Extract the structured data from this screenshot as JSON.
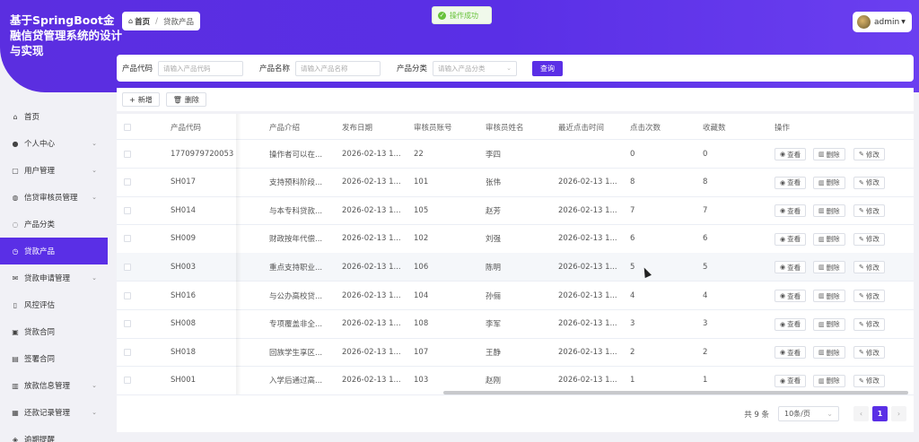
{
  "app": {
    "title": "基于SpringBoot金融信贷管理系统的设计与实现"
  },
  "breadcrumb": {
    "home": "首页",
    "separator": "/",
    "current": "贷款产品"
  },
  "toast": {
    "message": "操作成功"
  },
  "user": {
    "name": "admin"
  },
  "search": {
    "code_label": "产品代码",
    "code_placeholder": "请输入产品代码",
    "name_label": "产品名称",
    "name_placeholder": "请输入产品名称",
    "category_label": "产品分类",
    "category_placeholder": "请输入产品分类",
    "query_button": "查询"
  },
  "toolbar": {
    "add_label": "新增",
    "delete_label": "删除"
  },
  "sidebar": {
    "items": [
      {
        "label": "首页",
        "icon": "home-icon",
        "glyph": "⌂",
        "expandable": false,
        "active": false
      },
      {
        "label": "个人中心",
        "icon": "user-icon",
        "glyph": "●",
        "expandable": true,
        "active": false
      },
      {
        "label": "用户管理",
        "icon": "users-icon",
        "glyph": "▢",
        "expandable": true,
        "active": false
      },
      {
        "label": "信贷审核员管理",
        "icon": "reviewer-icon",
        "glyph": "◍",
        "expandable": true,
        "active": false
      },
      {
        "label": "产品分类",
        "icon": "category-icon",
        "glyph": "◌",
        "expandable": false,
        "active": false
      },
      {
        "label": "贷款产品",
        "icon": "clock-icon",
        "glyph": "◷",
        "expandable": false,
        "active": true
      },
      {
        "label": "贷款申请管理",
        "icon": "mail-icon",
        "glyph": "✉",
        "expandable": true,
        "active": false
      },
      {
        "label": "风控评估",
        "icon": "shield-icon",
        "glyph": "▯",
        "expandable": false,
        "active": false
      },
      {
        "label": "贷款合同",
        "icon": "contract-icon",
        "glyph": "▣",
        "expandable": false,
        "active": false
      },
      {
        "label": "签署合同",
        "icon": "sign-icon",
        "glyph": "▤",
        "expandable": false,
        "active": false
      },
      {
        "label": "放款信息管理",
        "icon": "loan-icon",
        "glyph": "▥",
        "expandable": true,
        "active": false
      },
      {
        "label": "还款记录管理",
        "icon": "repay-icon",
        "glyph": "▦",
        "expandable": true,
        "active": false
      },
      {
        "label": "逾期提醒",
        "icon": "alert-icon",
        "glyph": "◈",
        "expandable": false,
        "active": false
      }
    ]
  },
  "table": {
    "headers": [
      "产品代码",
      "产品介绍",
      "发布日期",
      "审核员账号",
      "审核员姓名",
      "最近点击时间",
      "点击次数",
      "收藏数",
      "操作"
    ],
    "actions": {
      "view": "查看",
      "delete": "删除",
      "edit": "修改"
    },
    "rows": [
      {
        "code": "1770979720053",
        "intro": "操作者可以在...",
        "date": "2026-02-13 1...",
        "account": "22",
        "name": "李四",
        "last_click": "",
        "clicks": "0",
        "favs": "0"
      },
      {
        "code": "SH017",
        "intro": "支持预科阶段...",
        "date": "2026-02-13 1...",
        "account": "101",
        "name": "张伟",
        "last_click": "2026-02-13 1...",
        "clicks": "8",
        "favs": "8"
      },
      {
        "code": "SH014",
        "intro": "与本专科贷款...",
        "date": "2026-02-13 1...",
        "account": "105",
        "name": "赵芳",
        "last_click": "2026-02-13 1...",
        "clicks": "7",
        "favs": "7"
      },
      {
        "code": "SH009",
        "intro": "财政按年代偿...",
        "date": "2026-02-13 1...",
        "account": "102",
        "name": "刘强",
        "last_click": "2026-02-13 1...",
        "clicks": "6",
        "favs": "6"
      },
      {
        "code": "SH003",
        "intro": "重点支持职业...",
        "date": "2026-02-13 1...",
        "account": "106",
        "name": "陈明",
        "last_click": "2026-02-13 1...",
        "clicks": "5",
        "favs": "5"
      },
      {
        "code": "SH016",
        "intro": "与公办高校贷...",
        "date": "2026-02-13 1...",
        "account": "104",
        "name": "孙俪",
        "last_click": "2026-02-13 1...",
        "clicks": "4",
        "favs": "4"
      },
      {
        "code": "SH008",
        "intro": "专项覆盖非全...",
        "date": "2026-02-13 1...",
        "account": "108",
        "name": "李军",
        "last_click": "2026-02-13 1...",
        "clicks": "3",
        "favs": "3"
      },
      {
        "code": "SH018",
        "intro": "回族学生享区...",
        "date": "2026-02-13 1...",
        "account": "107",
        "name": "王静",
        "last_click": "2026-02-13 1...",
        "clicks": "2",
        "favs": "2"
      },
      {
        "code": "SH001",
        "intro": "入学后通过高...",
        "date": "2026-02-13 1...",
        "account": "103",
        "name": "赵刚",
        "last_click": "2026-02-13 1...",
        "clicks": "1",
        "favs": "1"
      }
    ]
  },
  "pagination": {
    "total": "共 9 条",
    "page_size": "10条/页",
    "current_page": "1",
    "prev": "‹",
    "next": "›"
  },
  "colors": {
    "primary": "#5a2fe6",
    "success": "#67c23a"
  }
}
